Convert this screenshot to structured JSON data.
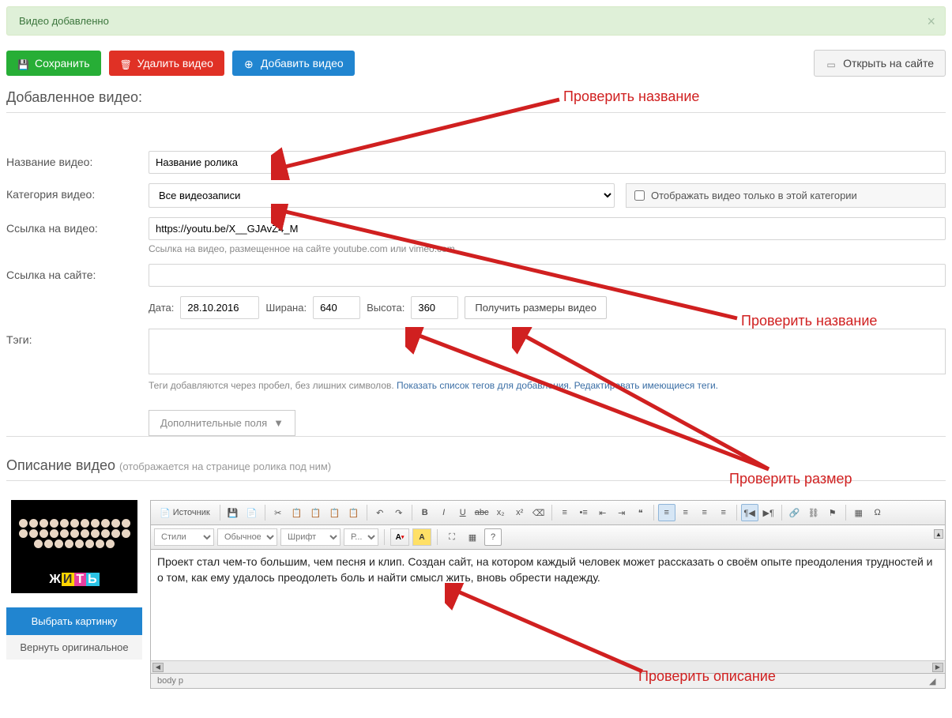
{
  "alert": {
    "text": "Видео добавленно"
  },
  "toolbar": {
    "save": "Сохранить",
    "delete": "Удалить видео",
    "add": "Добавить видео",
    "open_site": "Открыть на сайте"
  },
  "section1_title": "Добавленное видео:",
  "labels": {
    "title": "Название видео:",
    "category": "Категория видео:",
    "link": "Ссылка на видео:",
    "site_link": "Ссылка на сайте:",
    "tags": "Тэги:",
    "date": "Дата:",
    "width": "Ширана:",
    "height": "Высота:"
  },
  "fields": {
    "title_value": "Название ролика",
    "category_value": "Все видеозаписи",
    "only_in_category": "Отображать видео только в этой категории",
    "link_value": "https://youtu.be/X__GJAvZ4_M",
    "link_hint": "Ссылка на видео, размещенное на сайте youtube.com или vimeo.com",
    "site_link_value": "",
    "date_value": "28.10.2016",
    "width_value": "640",
    "height_value": "360",
    "get_size_btn": "Получить размеры видео",
    "tags_value": "",
    "tags_hint_prefix": "Теги добавляются через пробел, без лишних символов. ",
    "tags_hint_link1": "Показать список тегов для добавления.",
    "tags_hint_link2": "Редактировать имеющиеся теги.",
    "extra_fields_btn": "Дополнительные поля"
  },
  "description_section": {
    "title": "Описание видео",
    "subtitle": "(отображается на странице ролика под ним)"
  },
  "thumb": {
    "logo_text": "ЖИТЬ",
    "choose_btn": "Выбрать картинку",
    "revert_btn": "Вернуть оригинальное"
  },
  "editor": {
    "source_btn": "Источник",
    "style_select": "Стили",
    "format_select": "Обычное",
    "font_select": "Шрифт",
    "size_select": "Р...",
    "content": "Проект стал чем-то большим, чем песня и клип. Создан сайт, на котором каждый человек может рассказать о своём опыте преодоления трудностей и о том, как ему удалось преодолеть боль и найти смысл жить, вновь обрести надежду.",
    "path": "body  p"
  },
  "annotations": {
    "check_title": "Проверить название",
    "check_title2": "Проверить название",
    "check_size": "Проверить размер",
    "check_desc": "Проверить описание"
  }
}
